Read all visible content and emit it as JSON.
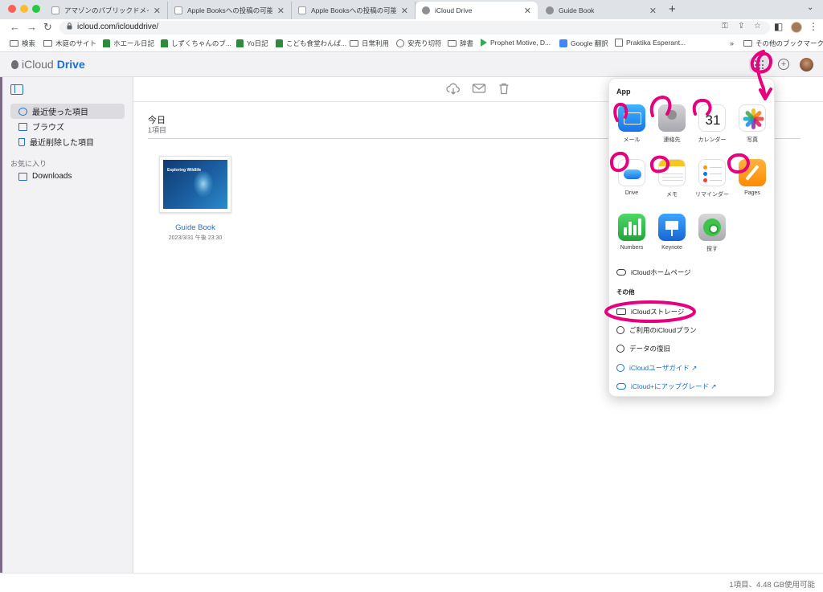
{
  "browser": {
    "tabs": [
      {
        "title": "アマゾンのパブリックドメイン..."
      },
      {
        "title": "Apple Booksへの投稿の可能性..."
      },
      {
        "title": "Apple Booksへの投稿の可能性..."
      },
      {
        "title": "iCloud Drive",
        "active": true
      },
      {
        "title": "Guide Book"
      }
    ],
    "new_tab": "+",
    "tab_menu": "⌄",
    "url": "icloud.com/iclouddrive/",
    "bookmarks": [
      {
        "label": "検索",
        "icon": "folder-icon"
      },
      {
        "label": "木庭のサイト",
        "icon": "folder-icon"
      },
      {
        "label": "ホエール日記",
        "icon": "bookmark-green-icon"
      },
      {
        "label": "しずくちゃんのブ...",
        "icon": "bookmark-green-icon"
      },
      {
        "label": "Yo日記",
        "icon": "bookmark-green-icon"
      },
      {
        "label": "こども食堂わんぱ...",
        "icon": "bookmark-green-icon"
      },
      {
        "label": "日常利用",
        "icon": "folder-icon"
      },
      {
        "label": "安売り切符",
        "icon": "globe-icon"
      },
      {
        "label": "辞書",
        "icon": "folder-icon"
      },
      {
        "label": "Prophet Motive, D...",
        "icon": "play-icon"
      },
      {
        "label": "Google 翻訳",
        "icon": "google-translate-icon"
      },
      {
        "label": "Praktika Esperant...",
        "icon": "calendar-icon"
      }
    ],
    "bookmarks_overflow": "»",
    "other_bookmarks": "その他のブックマーク"
  },
  "app": {
    "brand_icloud": "iCloud",
    "brand_drive": "Drive",
    "plus": "+"
  },
  "sidebar": {
    "items": [
      {
        "label": "最近使った項目",
        "icon": "clock-icon",
        "selected": true
      },
      {
        "label": "ブラウズ",
        "icon": "folder-icon"
      },
      {
        "label": "最近削除した項目",
        "icon": "trash-icon"
      }
    ],
    "favorites_title": "お気に入り",
    "favorites": [
      {
        "label": "Downloads",
        "icon": "folder-icon"
      }
    ]
  },
  "main": {
    "section_title": "今日",
    "section_count": "1項目",
    "files": [
      {
        "name": "Guide Book",
        "date": "2023/3/31 午後 23:30",
        "cover_text": "Exploring Wildlife"
      }
    ]
  },
  "footer": {
    "status": "1項目、4.48 GB使用可能"
  },
  "app_menu": {
    "heading": "App",
    "apps": [
      {
        "label": "メール",
        "icon": "mail-icon"
      },
      {
        "label": "連絡先",
        "icon": "contacts-icon"
      },
      {
        "label": "カレンダー",
        "icon": "calendar-icon",
        "day": "31"
      },
      {
        "label": "写真",
        "icon": "photos-icon"
      },
      {
        "label": "Drive",
        "icon": "drive-icon"
      },
      {
        "label": "メモ",
        "icon": "notes-icon"
      },
      {
        "label": "リマインダー",
        "icon": "reminders-icon"
      },
      {
        "label": "Pages",
        "icon": "pages-icon"
      },
      {
        "label": "Numbers",
        "icon": "numbers-icon"
      },
      {
        "label": "Keynote",
        "icon": "keynote-icon"
      },
      {
        "label": "探す",
        "icon": "find-my-icon"
      }
    ],
    "homepage_link": "iCloudホームページ",
    "other_heading": "その他",
    "other_links": [
      {
        "label": "iCloudストレージ",
        "icon": "storage-icon"
      },
      {
        "label": "ご利用のiCloudプラン",
        "icon": "plan-icon"
      },
      {
        "label": "データの復旧",
        "icon": "lifebuoy-icon"
      }
    ],
    "help_links": [
      {
        "label": "iCloudユーザガイド ↗",
        "icon": "help-icon"
      },
      {
        "label": "iCloud+にアップグレード ↗",
        "icon": "cloud-icon"
      }
    ]
  },
  "colors": {
    "accent": "#1f6fd1",
    "annotation": "#e6007e",
    "sidebar_bg": "#f2f2f4"
  }
}
